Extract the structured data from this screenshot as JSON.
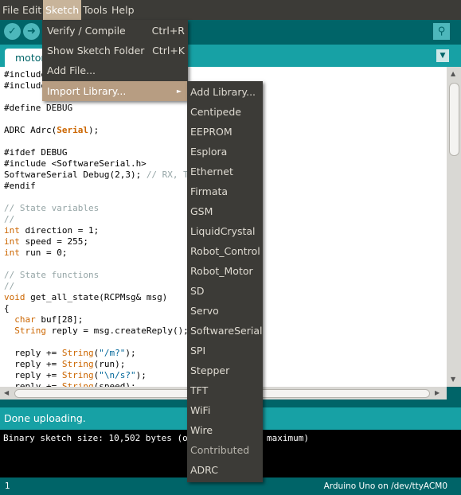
{
  "menubar": {
    "items": [
      "File",
      "Edit",
      "Sketch",
      "Tools",
      "Help"
    ],
    "active": "Sketch"
  },
  "toolbar": {
    "verify_icon": "✓",
    "upload_icon": "➜",
    "serial_icon": "⚲"
  },
  "tab": {
    "label": "motor",
    "menu_icon": "▼"
  },
  "editor": {
    "lines": [
      "#include",
      "#include",
      "",
      "#define DEBUG",
      "",
      "ADRC Adrc(Serial);",
      "",
      "#ifdef DEBUG",
      "#include <SoftwareSerial.h>",
      "SoftwareSerial Debug(2,3); // RX, T",
      "#endif",
      "",
      "// State variables",
      "//",
      "int direction = 1;",
      "int speed = 255;",
      "int run = 0;",
      "",
      "// State functions",
      "//",
      "void get_all_state(RCPMsg& msg)",
      "{",
      "  char buf[28];",
      "  String reply = msg.createReply();",
      "",
      "  reply += String(\"/m?\");",
      "  reply += String(run);",
      "  reply += String(\"\\n/s?\");",
      "  reply += String(speed);"
    ]
  },
  "sketch_menu": {
    "items": [
      {
        "label": "Verify / Compile",
        "shortcut": "Ctrl+R"
      },
      {
        "label": "Show Sketch Folder",
        "shortcut": "Ctrl+K"
      },
      {
        "label": "Add File...",
        "shortcut": ""
      },
      {
        "label": "Import Library...",
        "shortcut": "",
        "submenu_icon": "►"
      }
    ]
  },
  "library_menu": {
    "items": [
      "Add Library...",
      "Centipede",
      "EEPROM",
      "Esplora",
      "Ethernet",
      "Firmata",
      "GSM",
      "LiquidCrystal",
      "Robot_Control",
      "Robot_Motor",
      "SD",
      "Servo",
      "SoftwareSerial",
      "SPI",
      "Stepper",
      "TFT",
      "WiFi",
      "Wire",
      "Contributed",
      "ADRC"
    ],
    "header_index": 18
  },
  "status": {
    "message": "Done uploading."
  },
  "console": {
    "text_left": "Binary sketch size: 10,502 bytes (o",
    "text_right": "maximum)"
  },
  "footer": {
    "line": "1",
    "board": "Arduino Uno on /dev/ttyACM0"
  },
  "colors": {
    "menubar": "#3c3b37",
    "teal_dark": "#006468",
    "teal": "#17a1a5",
    "highlight": "#c8b49a",
    "keyword": "#cc6600"
  }
}
